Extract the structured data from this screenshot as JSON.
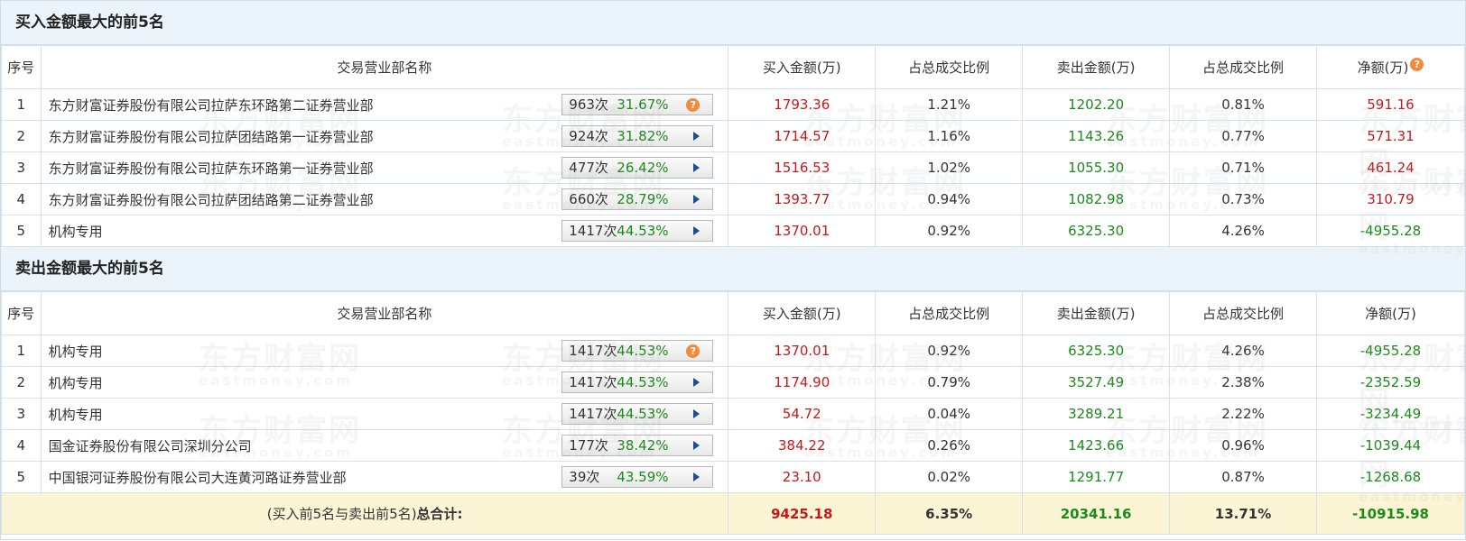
{
  "buy_section": {
    "title": "买入金额最大的前5名",
    "headers": [
      "序号",
      "交易营业部名称",
      "买入金额(万)",
      "占总成交比例",
      "卖出金额(万)",
      "占总成交比例",
      "净额(万)"
    ],
    "rows": [
      {
        "idx": "1",
        "name": "东方财富证券股份有限公司拉萨东环路第二证券营业部",
        "times": "963次",
        "pct": "31.67%",
        "icon": "question-icon",
        "buy": "1793.36",
        "buy_ratio": "1.21%",
        "sell": "1202.20",
        "sell_ratio": "0.81%",
        "net": "591.16",
        "net_color": "#c41a1a"
      },
      {
        "idx": "2",
        "name": "东方财富证券股份有限公司拉萨团结路第一证券营业部",
        "times": "924次",
        "pct": "31.82%",
        "icon": "play-arrow-icon",
        "buy": "1714.57",
        "buy_ratio": "1.16%",
        "sell": "1143.26",
        "sell_ratio": "0.77%",
        "net": "571.31",
        "net_color": "#c41a1a"
      },
      {
        "idx": "3",
        "name": "东方财富证券股份有限公司拉萨东环路第一证券营业部",
        "times": "477次",
        "pct": "26.42%",
        "icon": "play-arrow-icon",
        "buy": "1516.53",
        "buy_ratio": "1.02%",
        "sell": "1055.30",
        "sell_ratio": "0.71%",
        "net": "461.24",
        "net_color": "#c41a1a"
      },
      {
        "idx": "4",
        "name": "东方财富证券股份有限公司拉萨团结路第二证券营业部",
        "times": "660次",
        "pct": "28.79%",
        "icon": "play-arrow-icon",
        "buy": "1393.77",
        "buy_ratio": "0.94%",
        "sell": "1082.98",
        "sell_ratio": "0.73%",
        "net": "310.79",
        "net_color": "#c41a1a"
      },
      {
        "idx": "5",
        "name": "机构专用",
        "times": "1417次",
        "pct": "44.53%",
        "icon": "play-arrow-icon",
        "buy": "1370.01",
        "buy_ratio": "0.92%",
        "sell": "6325.30",
        "sell_ratio": "4.26%",
        "net": "-4955.28",
        "net_color": "#1c8a1c"
      }
    ]
  },
  "sell_section": {
    "title": "卖出金额最大的前5名",
    "headers": [
      "序号",
      "交易营业部名称",
      "买入金额(万)",
      "占总成交比例",
      "卖出金额(万)",
      "占总成交比例",
      "净额(万)"
    ],
    "rows": [
      {
        "idx": "1",
        "name": "机构专用",
        "times": "1417次",
        "pct": "44.53%",
        "icon": "question-icon",
        "buy": "1370.01",
        "buy_ratio": "0.92%",
        "sell": "6325.30",
        "sell_ratio": "4.26%",
        "net": "-4955.28",
        "net_color": "#1c8a1c"
      },
      {
        "idx": "2",
        "name": "机构专用",
        "times": "1417次",
        "pct": "44.53%",
        "icon": "play-arrow-icon",
        "buy": "1174.90",
        "buy_ratio": "0.79%",
        "sell": "3527.49",
        "sell_ratio": "2.38%",
        "net": "-2352.59",
        "net_color": "#1c8a1c"
      },
      {
        "idx": "3",
        "name": "机构专用",
        "times": "1417次",
        "pct": "44.53%",
        "icon": "play-arrow-icon",
        "buy": "54.72",
        "buy_ratio": "0.04%",
        "sell": "3289.21",
        "sell_ratio": "2.22%",
        "net": "-3234.49",
        "net_color": "#1c8a1c"
      },
      {
        "idx": "4",
        "name": "国金证券股份有限公司深圳分公司",
        "times": "177次",
        "pct": "38.42%",
        "icon": "play-arrow-icon",
        "buy": "384.22",
        "buy_ratio": "0.26%",
        "sell": "1423.66",
        "sell_ratio": "0.96%",
        "net": "-1039.44",
        "net_color": "#1c8a1c"
      },
      {
        "idx": "5",
        "name": "中国银河证券股份有限公司大连黄河路证券营业部",
        "times": "39次",
        "pct": "43.59%",
        "icon": "play-arrow-icon",
        "buy": "23.10",
        "buy_ratio": "0.02%",
        "sell": "1291.77",
        "sell_ratio": "0.87%",
        "net": "-1268.68",
        "net_color": "#1c8a1c"
      }
    ]
  },
  "total": {
    "label_prefix": "(买入前5名与卖出前5名)",
    "label_bold": "总合计:",
    "buy": "9425.18",
    "buy_ratio": "6.35%",
    "sell": "20341.16",
    "sell_ratio": "13.71%",
    "net": "-10915.98"
  },
  "watermark": {
    "cn": "东方财富网",
    "en": "eastmoney.com"
  },
  "colors": {
    "buy": "#c41a1a",
    "sell": "#1c8a1c",
    "header_bg": "#ecf4fb",
    "total_bg": "#fbf5d5"
  }
}
